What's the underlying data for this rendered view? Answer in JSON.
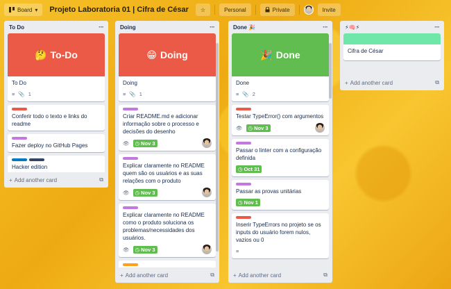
{
  "header": {
    "board_btn": "Board",
    "title": "Projeto Laboratoria 01 | Cifra de César",
    "visibility": "Personal",
    "privacy": "Private",
    "invite": "Invite"
  },
  "lists": [
    {
      "title": "To Do",
      "cover": {
        "emoji": "🤔",
        "text": "To-Do",
        "color": "#eb5a46"
      },
      "cover_card": {
        "title": "To Do",
        "attachments": "1"
      },
      "cards": [
        {
          "labels": [
            "#eb5a46"
          ],
          "title": "Conferir todo o texto e links do readme"
        },
        {
          "labels": [
            "#c377e0"
          ],
          "title": "Fazer deploy no GitHub Pages"
        },
        {
          "labels": [
            "#0079bf",
            "#344563"
          ],
          "title": "Hacker edition"
        }
      ],
      "add": "Add another card"
    },
    {
      "title": "Doing",
      "cover": {
        "emoji": "😁",
        "text": "Doing",
        "color": "#eb5a46"
      },
      "cover_card": {
        "title": "Doing",
        "attachments": "1"
      },
      "cards": [
        {
          "labels": [
            "#c377e0"
          ],
          "title": "Criar README.md e adicionar informação sobre o processo e decisões do desenho",
          "due": "Nov 3"
        },
        {
          "labels": [
            "#c377e0"
          ],
          "title": "Explicar claramente no README quem são os usuários e as suas relações com o produto",
          "due": "Nov 3"
        },
        {
          "labels": [
            "#c377e0"
          ],
          "title": "Explicar claramente no README como o produto soluciona os problemas/necessidades dos usuários.",
          "due": "Nov 3"
        }
      ],
      "add": "Add another card"
    },
    {
      "title": "Done 🎉",
      "cover": {
        "emoji": "🎉",
        "text": "Done",
        "color": "#61bd4f"
      },
      "cover_card": {
        "title": "Done",
        "attachments": "2"
      },
      "cards": [
        {
          "labels": [
            "#eb5a46"
          ],
          "title": "Testar TypeError() com argumentos",
          "due": "Nov 3",
          "member": true
        },
        {
          "labels": [
            "#c377e0"
          ],
          "title": "Passar o linter com a configuração definida",
          "due": "Oct 31"
        },
        {
          "labels": [
            "#c377e0"
          ],
          "title": "Passar as provas unitárias",
          "due": "Nov 1"
        },
        {
          "labels": [
            "#eb5a46"
          ],
          "title": "Inserir TypeErrors no projeto se os inputs do usuário forem nulos, vazios ou 0"
        }
      ],
      "add": "Add another card"
    },
    {
      "title": "⚡🧠⚡",
      "cards": [
        {
          "cover_color": "#6fe7a8",
          "title": "Cifra de César"
        }
      ],
      "add": "Add another card"
    }
  ],
  "icon_names": [
    "board-icon",
    "star-icon",
    "lock-icon",
    "description-icon",
    "attachment-icon",
    "watch-icon",
    "clock-icon",
    "plus-icon",
    "template-icon"
  ]
}
